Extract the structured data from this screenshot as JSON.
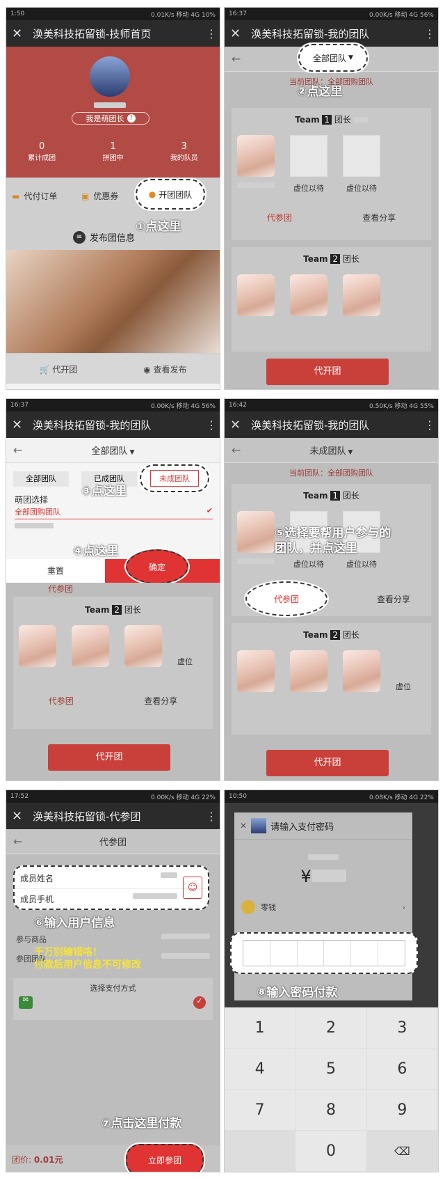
{
  "panels": [
    {
      "status": {
        "time": "1:50",
        "speed": "0.01K/s",
        "carrier": "移动 4G",
        "battery": "10%"
      },
      "title": "涣美科技拓留锁-技师首页",
      "profile": {
        "badge": "我是萌团长",
        "badge_q": "?"
      },
      "stats": [
        {
          "value": "0",
          "label": "累计成团"
        },
        {
          "value": "1",
          "label": "拼团中"
        },
        {
          "value": "3",
          "label": "我的队员"
        }
      ],
      "actions": {
        "daipay": "代付订单",
        "coupon": "优惠券",
        "open_team": "开团团队"
      },
      "callout": "①点这里",
      "publish": "发布团信息",
      "footer": {
        "open": "代开团",
        "view": "查看发布"
      }
    },
    {
      "status": {
        "time": "16:37",
        "speed": "0.00K/s",
        "carrier": "移动 4G",
        "battery": "56%"
      },
      "title": "涣美科技拓留锁-我的团队",
      "filter": "全部团队",
      "current": "当前团队：全部团购团队",
      "callout": "②点这里",
      "team1": "团长",
      "team1_num": "1",
      "team_prefix": "Team",
      "vacant": "虚位以待",
      "vacant_short": "虚位",
      "slot_text": "虚位以待",
      "join_btn": "代参团",
      "share_btn": "查看分享",
      "team2_num": "2",
      "open_btn": "代开团"
    },
    {
      "status": {
        "time": "16:37",
        "speed": "0.00K/s",
        "carrier": "移动 4G",
        "battery": "56%"
      },
      "title": "涣美科技拓留锁-我的团队",
      "filter": "全部团队",
      "tabs": [
        "全部团队",
        "已成团队",
        "未成团队"
      ],
      "group_label": "萌团选择",
      "group_item": "全部团购团队",
      "callout3": "③点这里",
      "callout4": "④点这里",
      "reset": "重置",
      "confirm": "确定",
      "join_btn": "代参团",
      "team2_num": "2",
      "team_prefix": "Team",
      "leader": "团长",
      "vacant_short": "虚位",
      "share_btn": "查看分享",
      "open_btn": "代开团"
    },
    {
      "status": {
        "time": "16:42",
        "speed": "0.50K/s",
        "carrier": "移动 4G",
        "battery": "55%"
      },
      "title": "涣美科技拓留锁-我的团队",
      "filter": "未成团队",
      "current": "当前团队：全部团购团队",
      "team_prefix": "Team",
      "team1_num": "1",
      "team2_num": "2",
      "leader": "团长",
      "callout": "⑤选择要帮用户参与的\n团队，并点这里",
      "vacant": "虚位以待",
      "vacant_short": "虚位",
      "join_btn": "代参团",
      "share_btn": "查看分享",
      "open_btn": "代开团"
    },
    {
      "status": {
        "time": "17:52",
        "speed": "0.00K/s",
        "carrier": "移动 4G",
        "battery": "22%"
      },
      "title": "涣美科技拓留锁-代参团",
      "subtitle": "代参团",
      "name_label": "成员姓名",
      "phone_label": "成员手机",
      "callout": "⑥输入用户信息",
      "product_label": "参与商品",
      "team_label": "参团团队",
      "warning1": "千万别输错咯！",
      "warning2": "付款后用户信息不可修改",
      "pay_method": "选择支付方式",
      "callout7": "⑦点击这里付款",
      "price_label": "团价:",
      "price": "0.01元",
      "pay_btn": "立即参团"
    },
    {
      "status": {
        "time": "10:50",
        "speed": "0.08K/s",
        "carrier": "移动 4G",
        "battery": "22%"
      },
      "dialog_title": "请输入支付密码",
      "currency": "¥",
      "wallet": "零钱",
      "callout": "⑧输入密码付款",
      "keys": [
        "1",
        "2",
        "3",
        "4",
        "5",
        "6",
        "7",
        "8",
        "9",
        "0"
      ]
    }
  ]
}
